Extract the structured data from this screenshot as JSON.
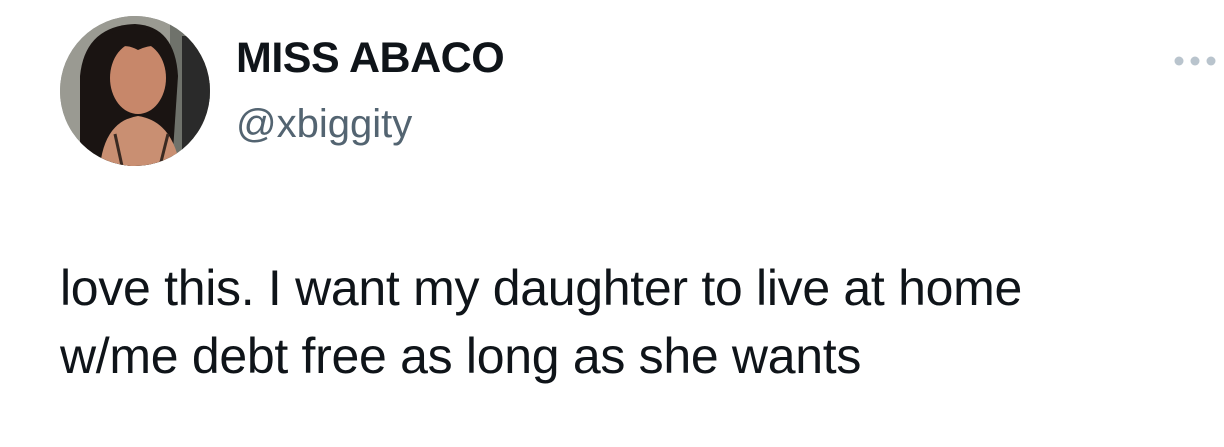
{
  "tweet": {
    "author": {
      "display_name": "MISS ABACO",
      "handle": "@xbiggity",
      "avatar_icon": "profile-photo"
    },
    "more_icon": "more-horizontal-icon",
    "text": "love this. I want my daughter to live at home\nw/me debt free as long as she wants"
  },
  "colors": {
    "text": "#0f1419",
    "secondary": "#536471",
    "icon": "#b9c4cd"
  }
}
